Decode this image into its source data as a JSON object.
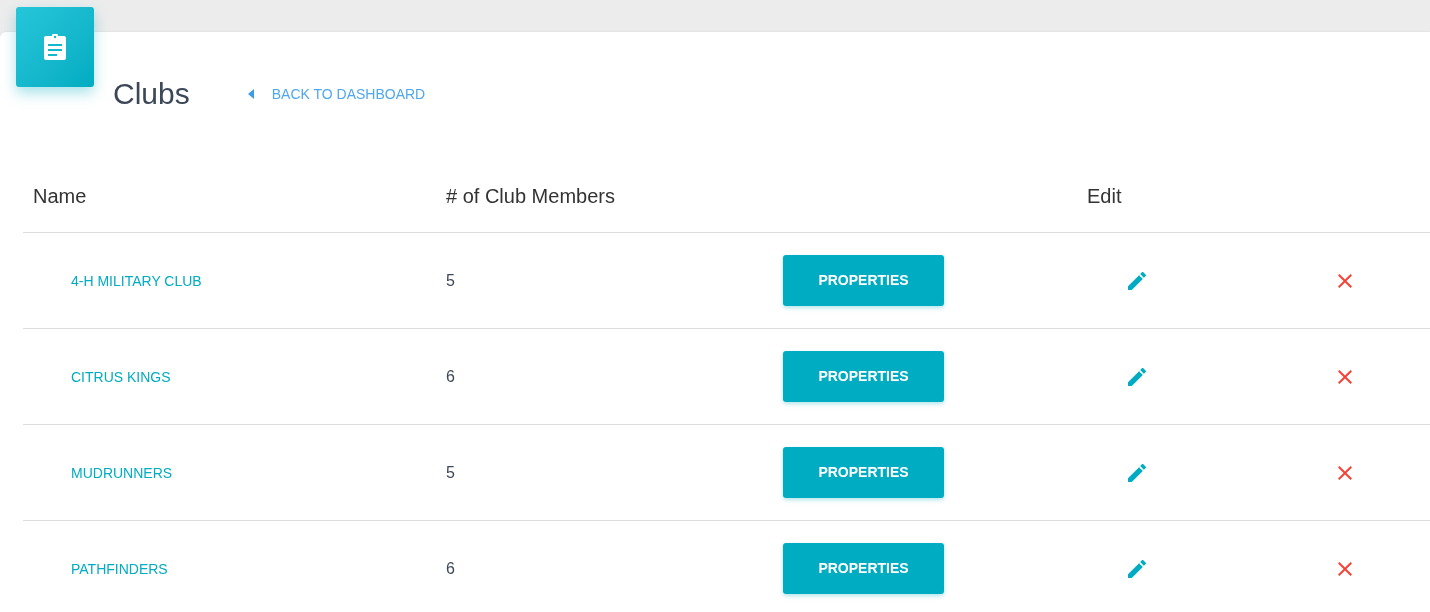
{
  "header": {
    "title": "Clubs",
    "back_link": {
      "label": "BACK TO DASHBOARD"
    }
  },
  "table": {
    "columns": {
      "name": "Name",
      "members": "# of Club Members",
      "edit": "Edit"
    },
    "rows": [
      {
        "name": "4-H MILITARY CLUB",
        "members": "5",
        "action": "PROPERTIES"
      },
      {
        "name": "CITRUS KINGS",
        "members": "6",
        "action": "PROPERTIES"
      },
      {
        "name": "MUDRUNNERS",
        "members": "5",
        "action": "PROPERTIES"
      },
      {
        "name": "PATHFINDERS",
        "members": "6",
        "action": "PROPERTIES"
      }
    ]
  }
}
